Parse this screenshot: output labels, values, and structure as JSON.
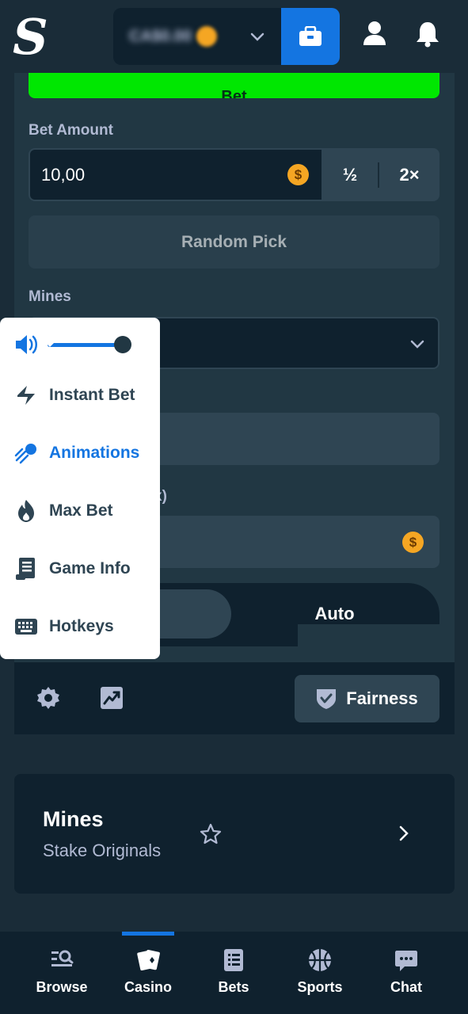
{
  "header": {
    "logo_letter": "S",
    "wallet_balance": "CA$0.00",
    "icons": [
      "wallet-icon",
      "user-icon",
      "bell-icon"
    ]
  },
  "game_form": {
    "bet_button_label": "Bet",
    "bet_amount_label": "Bet Amount",
    "bet_amount_value": "10,00",
    "currency_symbol": "$",
    "half_label": "½",
    "double_label": "2×",
    "random_pick_label": "Random Pick",
    "mines_label": "Mines",
    "profit_label_fragment": "x)",
    "mode_manual_fragment": "l",
    "mode_auto_label": "Auto"
  },
  "settings_menu": {
    "volume_level": 1.0,
    "items": [
      {
        "label": "Instant Bet",
        "icon": "lightning-icon",
        "active": false
      },
      {
        "label": "Animations",
        "icon": "comet-icon",
        "active": true
      },
      {
        "label": "Max Bet",
        "icon": "flame-icon",
        "active": false
      },
      {
        "label": "Game Info",
        "icon": "scroll-icon",
        "active": false
      },
      {
        "label": "Hotkeys",
        "icon": "keyboard-icon",
        "active": false
      }
    ]
  },
  "footer_controls": {
    "fairness_label": "Fairness"
  },
  "game_card": {
    "title": "Mines",
    "subtitle": "Stake Originals"
  },
  "bottom_nav": {
    "active": "Casino",
    "items": [
      {
        "label": "Browse",
        "icon": "browse-icon"
      },
      {
        "label": "Casino",
        "icon": "cards-icon"
      },
      {
        "label": "Bets",
        "icon": "bets-icon"
      },
      {
        "label": "Sports",
        "icon": "basketball-icon"
      },
      {
        "label": "Chat",
        "icon": "chat-icon"
      }
    ]
  },
  "colors": {
    "background": "#1a2c38",
    "panel": "#213743",
    "input": "#0f212e",
    "button": "#2f4553",
    "accent_blue": "#1475e1",
    "bet_green": "#00e701",
    "coin": "#f5a623"
  }
}
